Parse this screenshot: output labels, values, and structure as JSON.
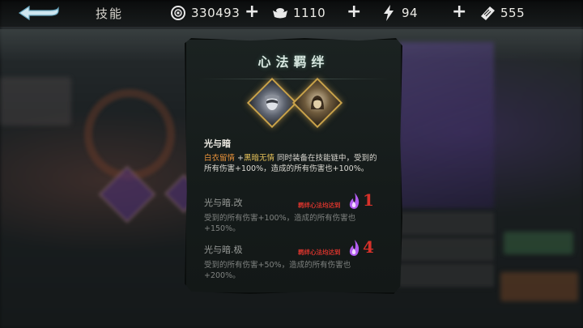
{
  "topbar": {
    "title": "技能",
    "resources": [
      {
        "icon": "coin-icon",
        "value": "330493"
      },
      {
        "icon": "ingot-icon",
        "value": "1110"
      },
      {
        "icon": "lightning-icon",
        "value": "94"
      },
      {
        "icon": "ticket-icon",
        "value": "555"
      }
    ]
  },
  "dialog": {
    "title": "心法羁绊",
    "bond": {
      "name": "光与暗",
      "desc_part1": "白衣留情",
      "desc_plus": " +",
      "desc_part2": "黑暗无情",
      "desc_rest": " 同时装备在技能链中，受到的所有伤害+100%，造成的所有伤害也+100%。"
    },
    "upgrades": [
      {
        "name": "光与暗.改",
        "requirement": "羁绊心法均达到",
        "level": "1",
        "desc": "受到的所有伤害+100%，造成的所有伤害也+150%。"
      },
      {
        "name": "光与暗.极",
        "requirement": "羁绊心法均达到",
        "level": "4",
        "desc": "受到的所有伤害+50%，造成的所有伤害也+200%。"
      }
    ]
  },
  "colors": {
    "accent_orange": "#e8923a",
    "accent_yellow": "#e6c25a",
    "requirement_red": "#d6312a",
    "flame_purple": "#b25cf0"
  }
}
